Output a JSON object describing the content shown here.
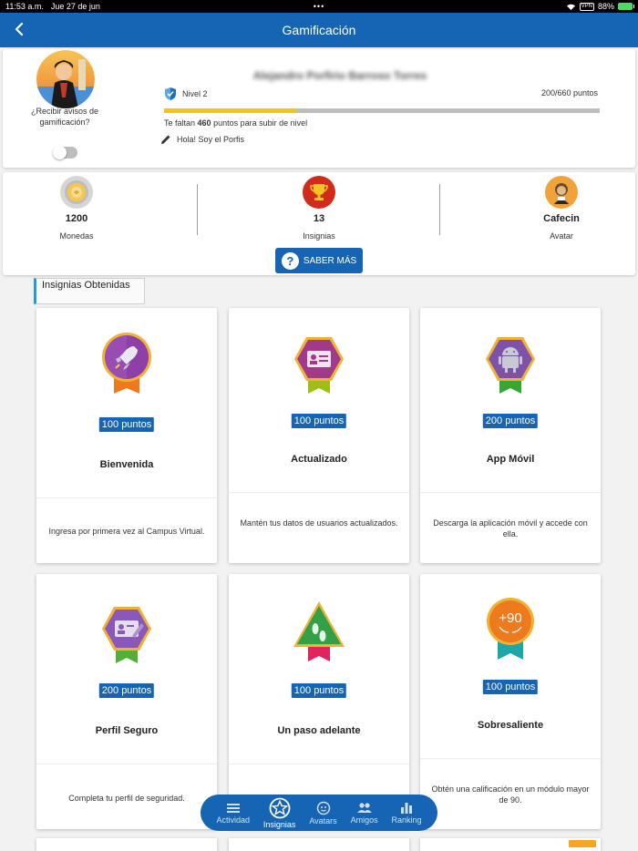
{
  "status_bar": {
    "time": "11:53 a.m.",
    "date": "Jue 27 de jun",
    "vpn": "VPN",
    "battery": "88%"
  },
  "header": {
    "title": "Gamificación"
  },
  "profile": {
    "notify_label": "¿Recibir avisos de gamificación?",
    "user_name": "Alejandro Porfirio Barroso Torres",
    "level": "Nivel 2",
    "points": "200/660 puntos",
    "progress_fraction": 0.303,
    "missing_prefix": "Te faltan ",
    "missing_points": "460",
    "missing_suffix": " puntos para subir de nivel",
    "status_message": "Hola! Soy el Porfis"
  },
  "stats": [
    {
      "value": "1200",
      "label": "Monedas",
      "icon": "coin-icon"
    },
    {
      "value": "13",
      "label": "Insignias",
      "icon": "trophy-icon"
    },
    {
      "value": "Cafecin",
      "label": "Avatar",
      "icon": "avatar-icon"
    }
  ],
  "learn_more_label": "SABER MÁS",
  "section_label": "Insignias Obtenidas",
  "badges": [
    {
      "points": "100 puntos",
      "name": "Bienvenida",
      "desc": "Ingresa por primera vez al Campus Virtual.",
      "icon": "rocket-icon",
      "shape": "circle",
      "color": "#8e3fa8",
      "ribbon": "#f0781e"
    },
    {
      "points": "100 puntos",
      "name": "Actualizado",
      "desc": "Mantén tus datos de usuarios actualizados.",
      "icon": "id-card-icon",
      "shape": "hexagon",
      "color": "#a13a8a",
      "ribbon": "#9cbf17"
    },
    {
      "points": "200 puntos",
      "name": "App Móvil",
      "desc": "Descarga la aplicación móvil y accede con ella.",
      "icon": "android-icon",
      "shape": "hexagon",
      "color": "#7e52a8",
      "ribbon": "#3aa43a"
    },
    {
      "points": "200 puntos",
      "name": "Perfil Seguro",
      "desc": "Completa tu perfil de seguridad.",
      "icon": "id-card-edit-icon",
      "shape": "hexagon",
      "color": "#8a58b8",
      "ribbon": "#52b038"
    },
    {
      "points": "100 puntos",
      "name": "Un paso adelante",
      "desc": "",
      "icon": "footsteps-icon",
      "shape": "triangle",
      "color": "#32a046",
      "ribbon": "#e0245e"
    },
    {
      "points": "100 puntos",
      "name": "Sobresaliente",
      "desc": "Obtén una calificación en un módulo mayor de 90.",
      "icon": "plus-ninety-icon",
      "shape": "circle",
      "color": "#ee7a1e",
      "ribbon": "#1fa6a6",
      "badge_text": "+90"
    }
  ],
  "nav": [
    {
      "label": "Actividad",
      "icon": "activity-list-icon",
      "active": false
    },
    {
      "label": "Insignias",
      "icon": "star-badge-icon",
      "active": true
    },
    {
      "label": "Avatars",
      "icon": "face-icon",
      "active": false
    },
    {
      "label": "Amigos",
      "icon": "friends-icon",
      "active": false
    },
    {
      "label": "Ranking",
      "icon": "bar-chart-icon",
      "active": false
    }
  ],
  "colors": {
    "primary": "#1565b4",
    "progress": "#f3c315",
    "section_accent": "#2196f3"
  }
}
